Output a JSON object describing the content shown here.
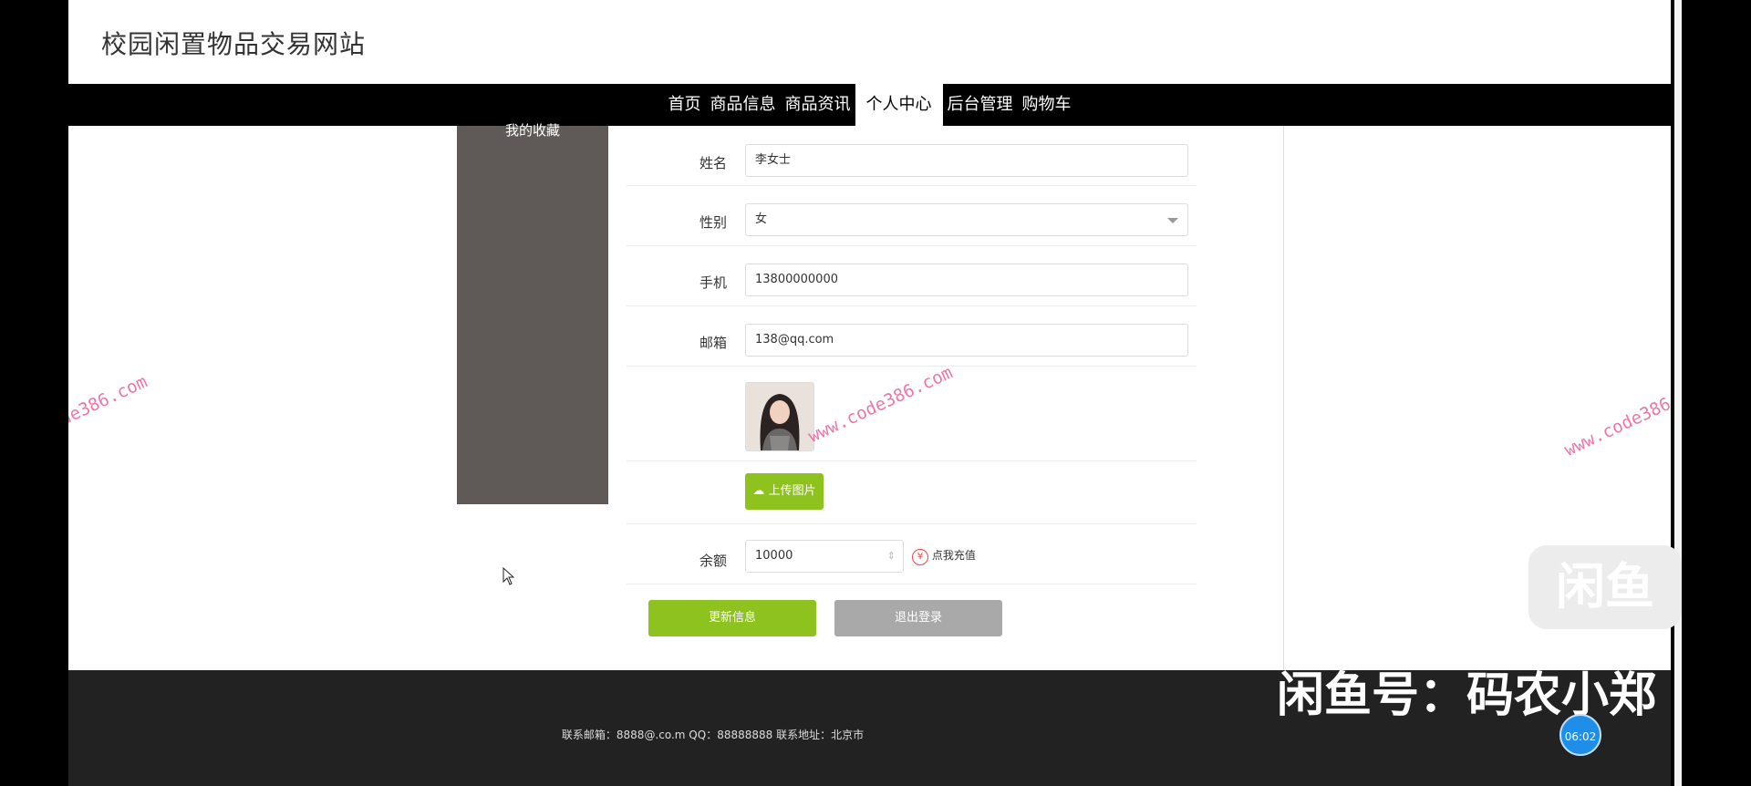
{
  "site": {
    "title": "校园闲置物品交易网站"
  },
  "nav": {
    "items": [
      "首页",
      "商品信息",
      "商品资讯",
      "个人中心",
      "后台管理",
      "购物车"
    ],
    "active_index": 3
  },
  "sidebar": {
    "items": [
      "我的收藏"
    ]
  },
  "form": {
    "name_label": "姓名",
    "name_value": "李女士",
    "gender_label": "性别",
    "gender_value": "女",
    "phone_label": "手机",
    "phone_value": "13800000000",
    "email_label": "邮箱",
    "email_value": "138@qq.com",
    "upload_label": "上传图片",
    "balance_label": "余额",
    "balance_value": "10000",
    "recharge_label": "点我充值",
    "update_button": "更新信息",
    "logout_button": "退出登录"
  },
  "footer": {
    "text": "联系邮箱：8888@.co.m QQ：88888888 联系地址：北京市"
  },
  "overlays": {
    "watermark": "www.code386.com",
    "bottom_banner": "闲鱼号：码农小郑",
    "logo_text": "闲鱼",
    "timer": "06:02"
  },
  "colors": {
    "accent": "#8ec21f",
    "nav_bg": "#000000",
    "sidebar_bg": "#5f5a57",
    "footer_bg": "#222222"
  }
}
